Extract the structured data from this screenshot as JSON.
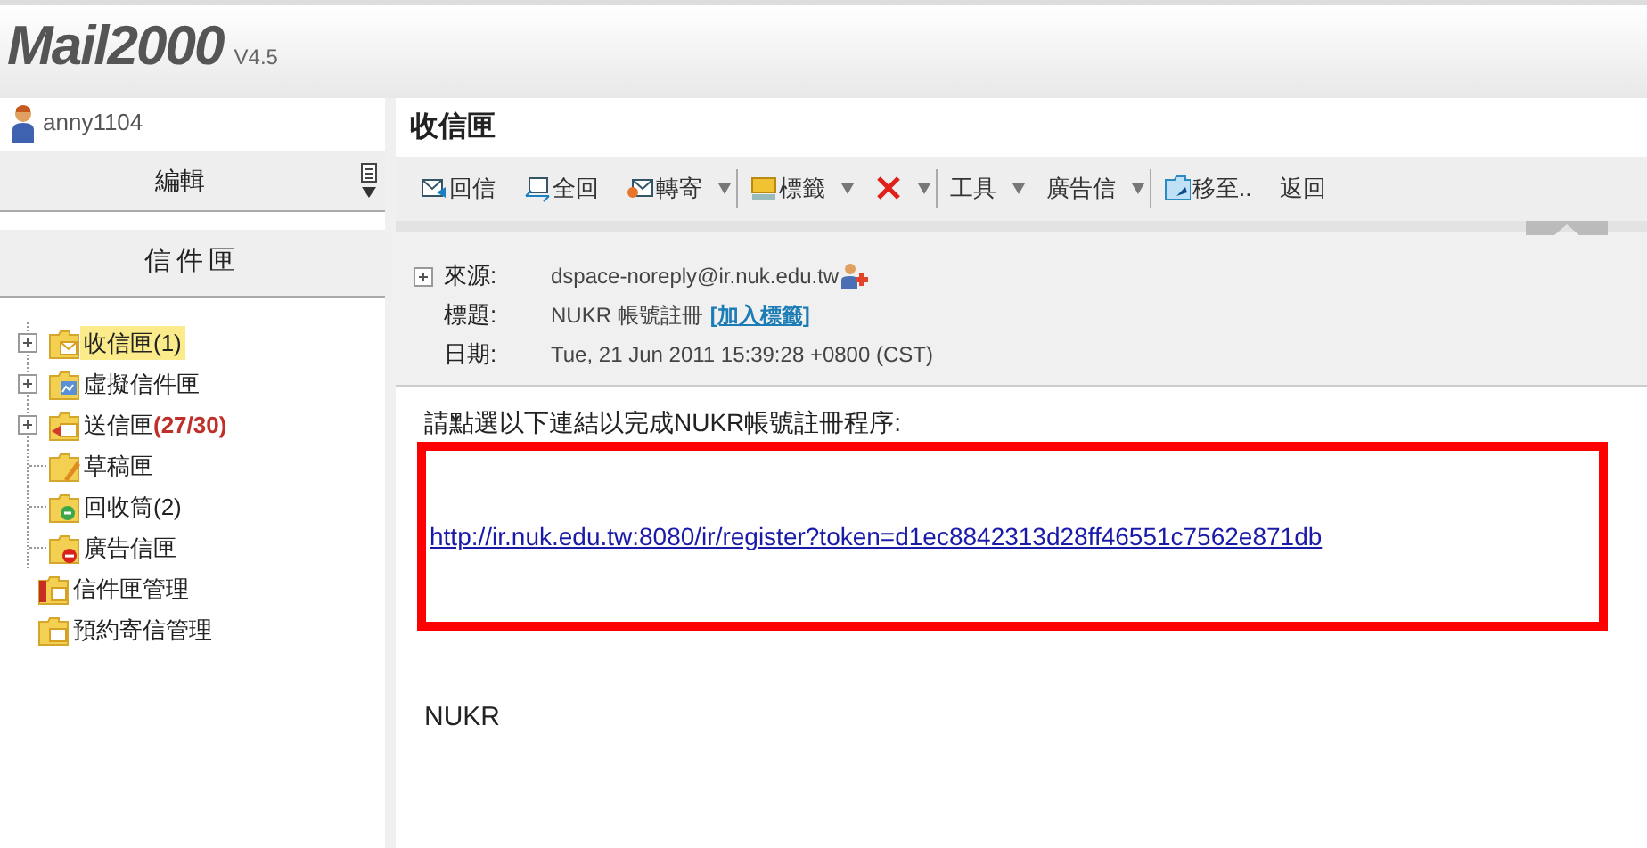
{
  "logo": {
    "name": "Mail2000",
    "version": "V4.5"
  },
  "user": {
    "name": "anny1104"
  },
  "sidebar": {
    "edit_label": "編輯",
    "section_title": "信件匣",
    "folders": [
      {
        "kind": "inbox",
        "label": "收信匣",
        "count": "(1)",
        "count_alert": false,
        "expandable": true,
        "selected": true,
        "in_tree": true
      },
      {
        "kind": "virtual",
        "label": "虛擬信件匣",
        "expandable": true,
        "selected": false,
        "in_tree": true
      },
      {
        "kind": "sent",
        "label": "送信匣",
        "count": "(27/30)",
        "count_alert": true,
        "expandable": true,
        "selected": false,
        "in_tree": true
      },
      {
        "kind": "drafts",
        "label": "草稿匣",
        "expandable": false,
        "selected": false,
        "in_tree": true
      },
      {
        "kind": "trash",
        "label": "回收筒",
        "count": "(2)",
        "count_alert": false,
        "expandable": false,
        "selected": false,
        "in_tree": true
      },
      {
        "kind": "spam",
        "label": "廣告信匣",
        "expandable": false,
        "selected": false,
        "in_tree": true
      },
      {
        "kind": "manage",
        "label": "信件匣管理",
        "expandable": false,
        "selected": false,
        "in_tree": false
      },
      {
        "kind": "schedule",
        "label": "預約寄信管理",
        "expandable": false,
        "selected": false,
        "in_tree": false
      }
    ]
  },
  "main": {
    "title": "收信匣",
    "toolbar": [
      {
        "kind": "reply",
        "label": "回信",
        "dropdown": false,
        "separator_after": false
      },
      {
        "kind": "reply_all",
        "label": "全回",
        "dropdown": false,
        "separator_after": false
      },
      {
        "kind": "forward",
        "label": "轉寄",
        "dropdown": true,
        "separator_after": true
      },
      {
        "kind": "tag",
        "label": "標籤",
        "dropdown": true,
        "separator_after": false
      },
      {
        "kind": "delete",
        "dropdown": true,
        "separator_after": true
      },
      {
        "kind": "text",
        "label": "工具",
        "dropdown": true,
        "separator_after": false
      },
      {
        "kind": "text",
        "label": "廣告信",
        "dropdown": true,
        "separator_after": true
      },
      {
        "kind": "move",
        "label": "移至..",
        "dropdown": false,
        "separator_after": false
      },
      {
        "kind": "text",
        "label": "返回",
        "dropdown": false,
        "separator_after": false
      }
    ],
    "message": {
      "from_label": "來源:",
      "from": "dspace-noreply@ir.nuk.edu.tw",
      "subject_label": "標題:",
      "subject": "NUKR 帳號註冊",
      "add_tag": "[加入標籤]",
      "date_label": "日期:",
      "date": "Tue, 21 Jun 2011 15:39:28 +0800 (CST)",
      "body_intro": "請點選以下連結以完成NUKR帳號註冊程序:",
      "link": "http://ir.nuk.edu.tw:8080/ir/register?token=d1ec8842313d28ff46551c7562e871db",
      "signature": "NUKR"
    }
  }
}
